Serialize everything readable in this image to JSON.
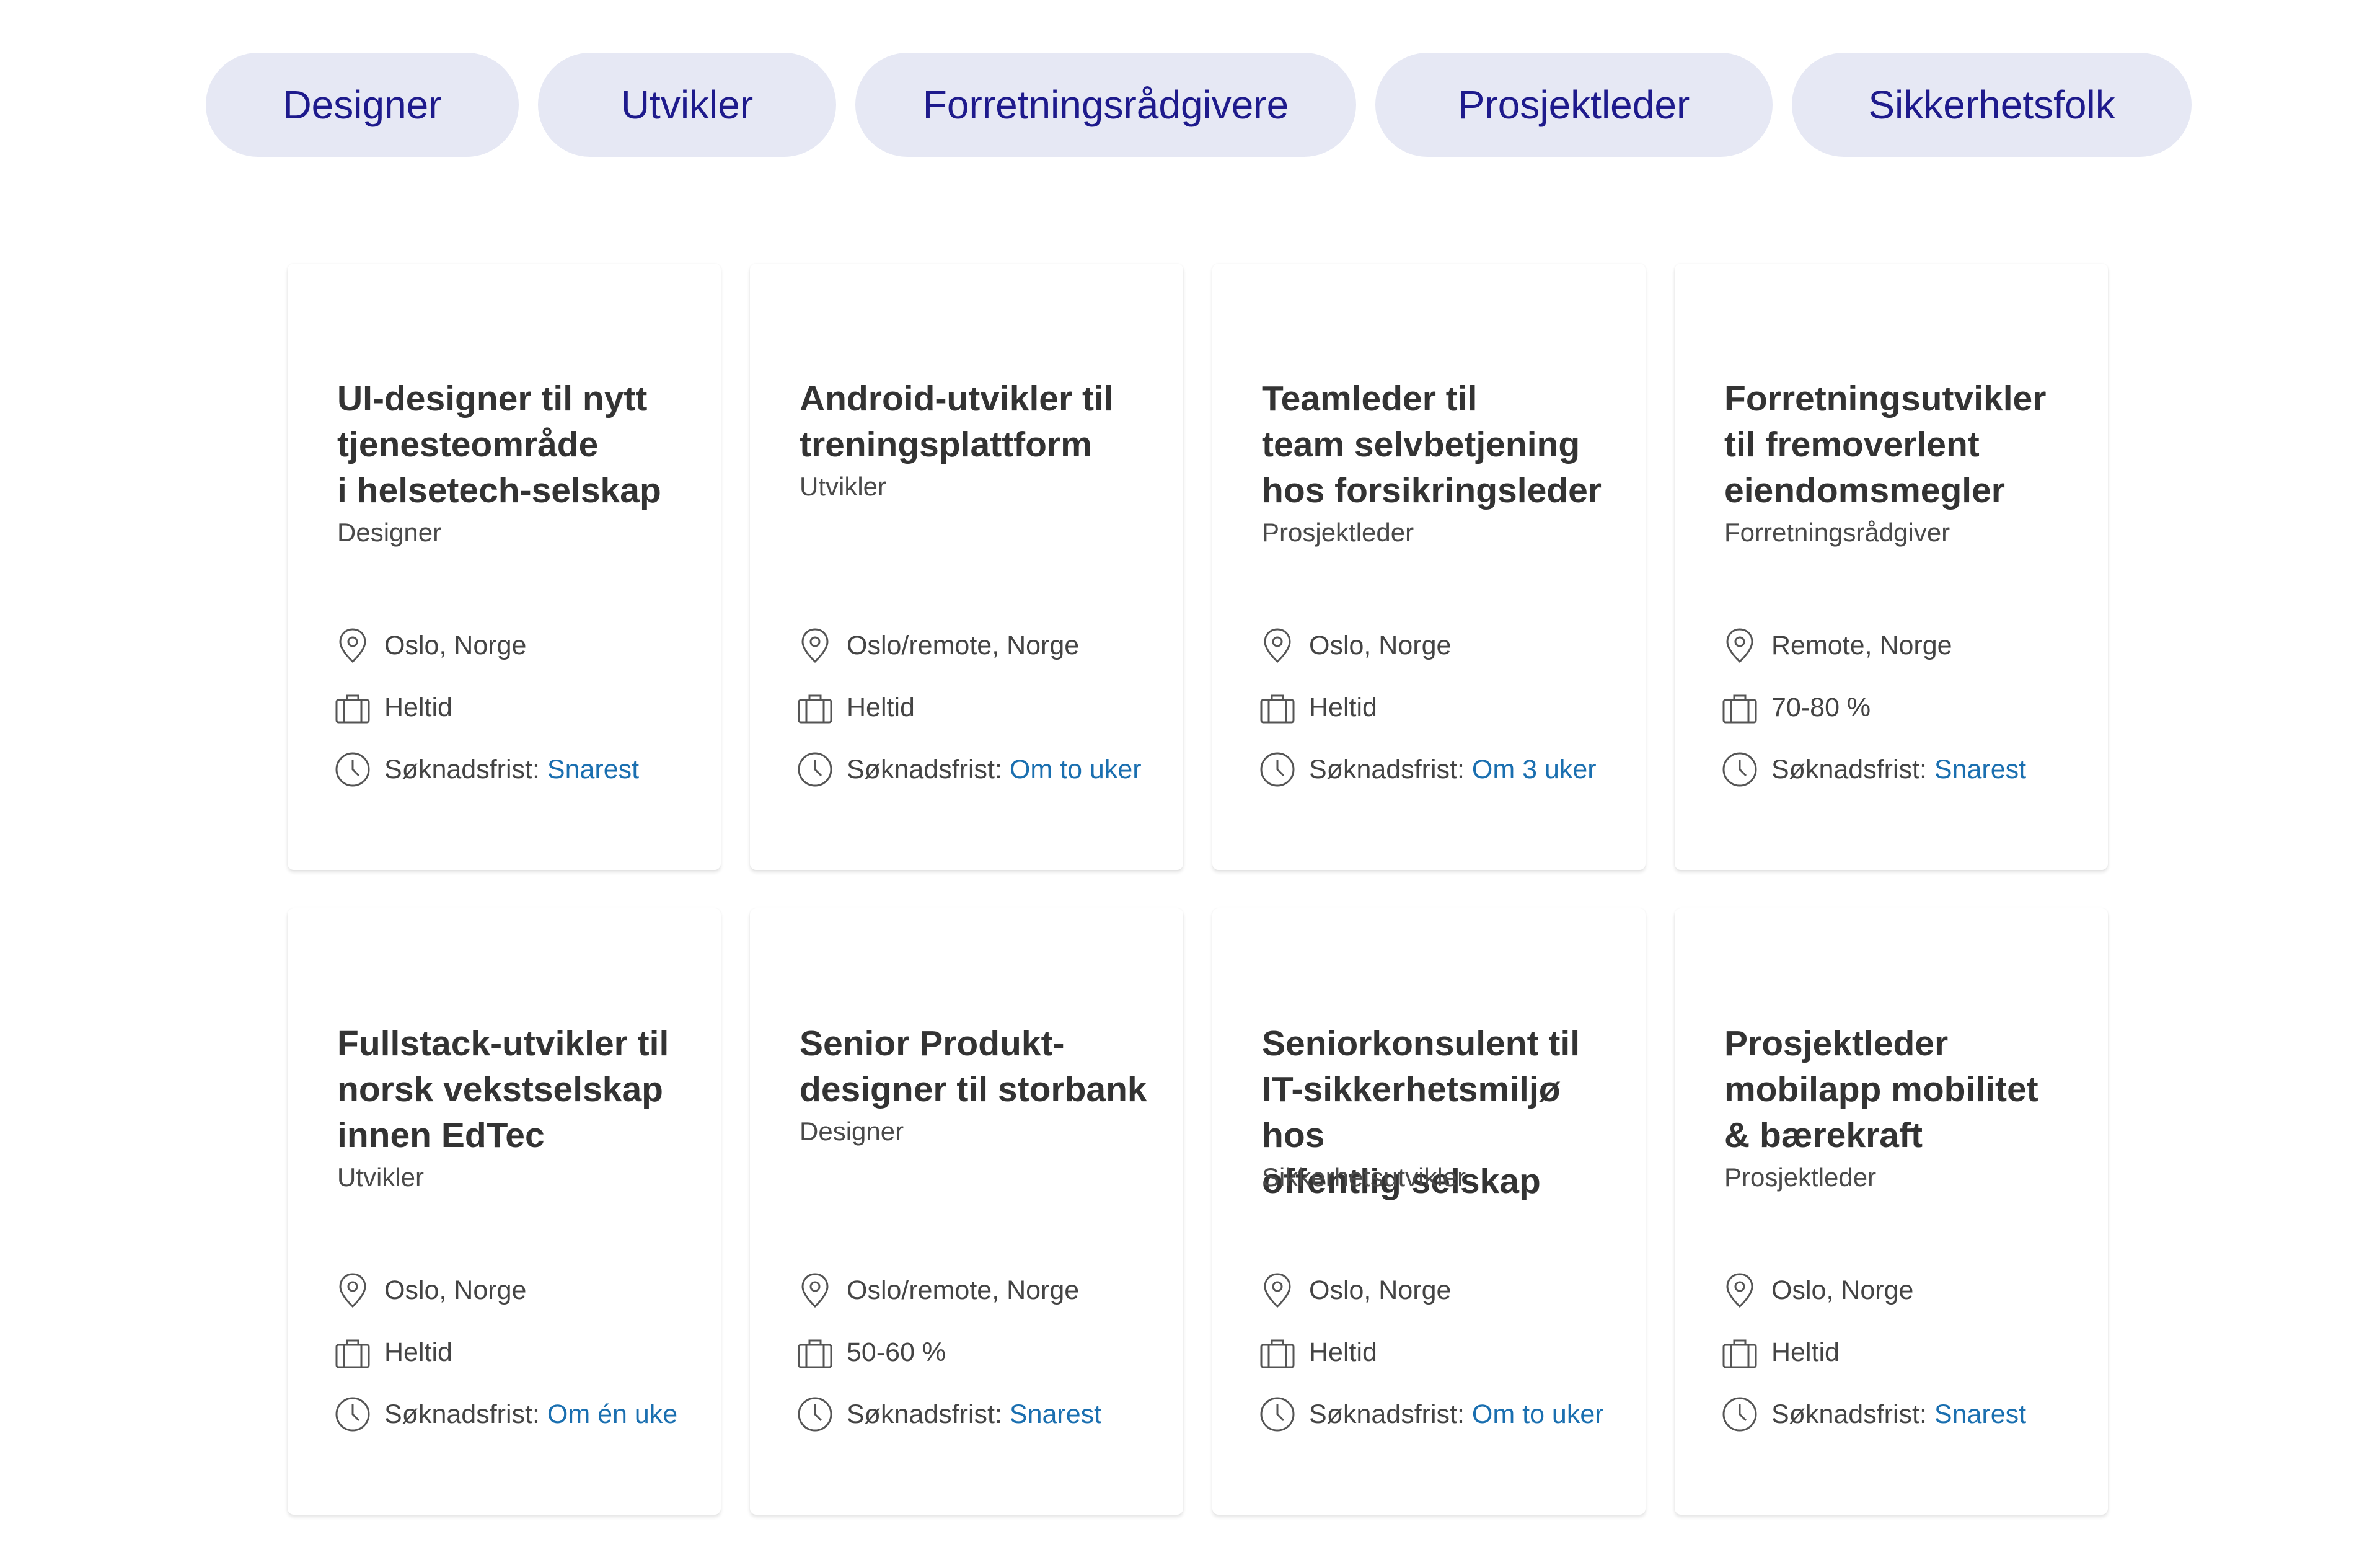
{
  "filters": [
    {
      "label": "Designer"
    },
    {
      "label": "Utvikler"
    },
    {
      "label": "Forretningsrådgivere"
    },
    {
      "label": "Prosjektleder"
    },
    {
      "label": "Sikkerhetsfolk"
    }
  ],
  "deadline_label": "Søknadsfrist:",
  "icons": {
    "location": "location-pin-icon",
    "employment": "briefcase-icon",
    "deadline": "clock-icon"
  },
  "colors": {
    "pill_background": "#e6e8f4",
    "pill_text": "#1e1a8c",
    "deadline_link": "#1a6fb0"
  },
  "jobs": [
    {
      "title": "UI-designer til nytt\ntjenesteområde\ni helsetech-selskap",
      "category": "Designer",
      "location": "Oslo, Norge",
      "employment": "Heltid",
      "deadline": "Snarest"
    },
    {
      "title": "Android-utvikler til\ntreningsplattform",
      "category": "Utvikler",
      "location": "Oslo/remote, Norge",
      "employment": "Heltid",
      "deadline": "Om to uker"
    },
    {
      "title": "Teamleder til\nteam selvbetjening\nhos forsikringsleder",
      "category": "Prosjektleder",
      "location": "Oslo, Norge",
      "employment": "Heltid",
      "deadline": "Om 3 uker"
    },
    {
      "title": "Forretningsutvikler\ntil fremoverlent\neiendomsmegler",
      "category": "Forretningsrådgiver",
      "location": "Remote, Norge",
      "employment": "70-80 %",
      "deadline": "Snarest"
    },
    {
      "title": "Fullstack-utvikler til\nnorsk vekstselskap\ninnen EdTec",
      "category": "Utvikler",
      "location": "Oslo, Norge",
      "employment": "Heltid",
      "deadline": "Om én uke"
    },
    {
      "title": "Senior Produkt-\ndesigner til storbank",
      "category": "Designer",
      "location": "Oslo/remote, Norge",
      "employment": "50-60 %",
      "deadline": "Snarest"
    },
    {
      "title": "Seniorkonsulent til\nIT-sikkerhetsmiljø hos\noffentlig selskap",
      "category": "Sikkerhetsutvikler",
      "location": "Oslo, Norge",
      "employment": "Heltid",
      "deadline": "Om to uker"
    },
    {
      "title": "Prosjektleder\nmobilapp mobilitet\n& bærekraft",
      "category": "Prosjektleder",
      "location": "Oslo, Norge",
      "employment": "Heltid",
      "deadline": "Snarest"
    }
  ]
}
